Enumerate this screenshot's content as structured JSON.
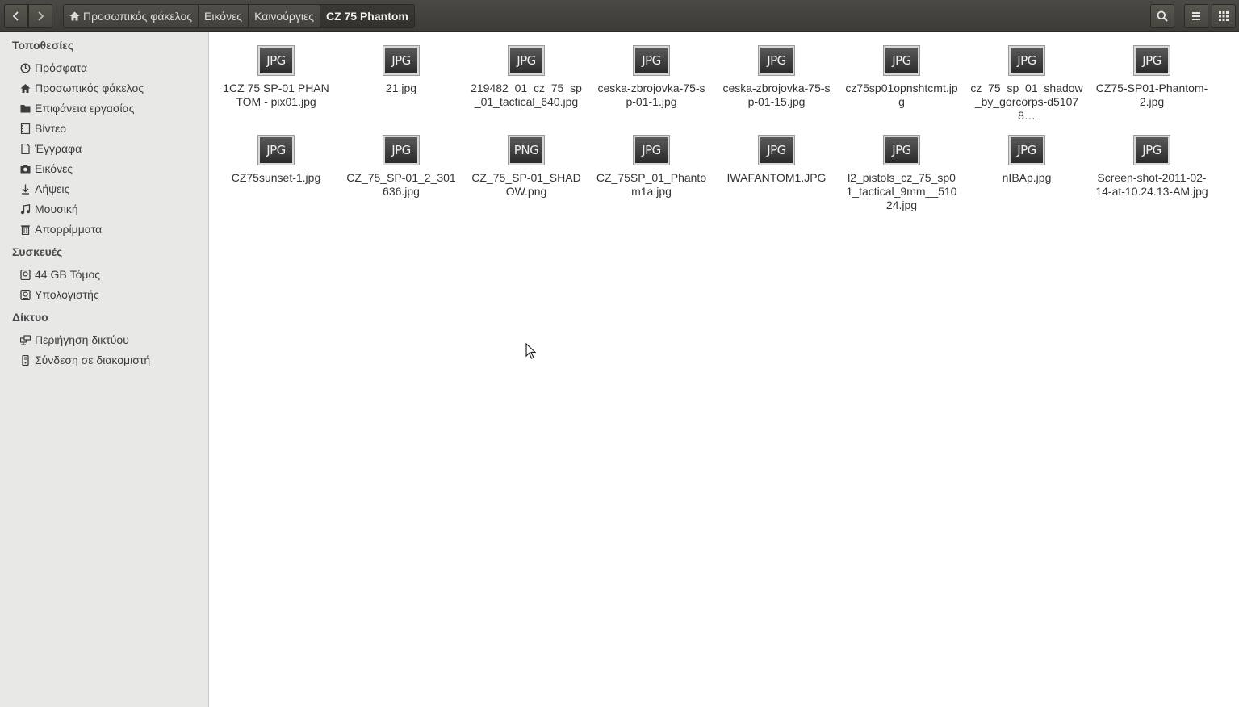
{
  "nav": {
    "back_icon": "chevron-left-icon",
    "forward_icon": "chevron-right-icon"
  },
  "breadcrumbs": [
    "Προσωπικός φάκελος",
    "Εικόνες",
    "Καινούργιες",
    "CZ 75 Phantom"
  ],
  "toolbar": {
    "search_icon": "search-icon",
    "menu_icon": "hamburger-icon",
    "view_icon": "grid-icon"
  },
  "sidebar": {
    "places_heading": "Τοποθεσίες",
    "places": [
      {
        "label": "Πρόσφατα",
        "icon": "clock-icon"
      },
      {
        "label": "Προσωπικός φάκελος",
        "icon": "home-icon"
      },
      {
        "label": "Επιφάνεια εργασίας",
        "icon": "folder-icon"
      },
      {
        "label": "Βίντεο",
        "icon": "film-icon"
      },
      {
        "label": "Έγγραφα",
        "icon": "document-icon"
      },
      {
        "label": "Εικόνες",
        "icon": "camera-icon"
      },
      {
        "label": "Λήψεις",
        "icon": "download-icon"
      },
      {
        "label": "Μουσική",
        "icon": "music-icon"
      },
      {
        "label": "Απορρίμματα",
        "icon": "trash-icon"
      }
    ],
    "devices_heading": "Συσκευές",
    "devices": [
      {
        "label": "44 GB Τόμος",
        "icon": "drive-icon"
      },
      {
        "label": "Υπολογιστής",
        "icon": "drive-icon"
      }
    ],
    "network_heading": "Δίκτυο",
    "network": [
      {
        "label": "Περιήγηση δικτύου",
        "icon": "network-icon"
      },
      {
        "label": "Σύνδεση σε διακομιστή",
        "icon": "server-icon"
      }
    ]
  },
  "files": [
    {
      "type": "JPG",
      "name": "1CZ 75 SP-01 PHANTOM - pix01.jpg"
    },
    {
      "type": "JPG",
      "name": "21.jpg"
    },
    {
      "type": "JPG",
      "name": "219482_01_cz_75_sp_01_tactical_640.jpg"
    },
    {
      "type": "JPG",
      "name": "ceska-zbrojovka-75-sp-01-1.jpg"
    },
    {
      "type": "JPG",
      "name": "ceska-zbrojovka-75-sp-01-15.jpg"
    },
    {
      "type": "JPG",
      "name": "cz75sp01opnshtcmt.jpg"
    },
    {
      "type": "JPG",
      "name": "cz_75_sp_01_shadow_by_gorcorps-d51078…"
    },
    {
      "type": "JPG",
      "name": "CZ75-SP01-Phantom-2.jpg"
    },
    {
      "type": "JPG",
      "name": "CZ75sunset-1.jpg"
    },
    {
      "type": "JPG",
      "name": "CZ_75_SP-01_2_301636.jpg"
    },
    {
      "type": "PNG",
      "name": "CZ_75_SP-01_SHADOW.png"
    },
    {
      "type": "JPG",
      "name": "CZ_75SP_01_Phantom1a.jpg"
    },
    {
      "type": "JPG",
      "name": "IWAFANTOM1.JPG"
    },
    {
      "type": "JPG",
      "name": "l2_pistols_cz_75_sp01_tactical_9mm__51024.jpg"
    },
    {
      "type": "JPG",
      "name": "nIBAp.jpg"
    },
    {
      "type": "JPG",
      "name": "Screen-shot-2011-02-14-at-10.24.13-AM.jpg"
    }
  ]
}
